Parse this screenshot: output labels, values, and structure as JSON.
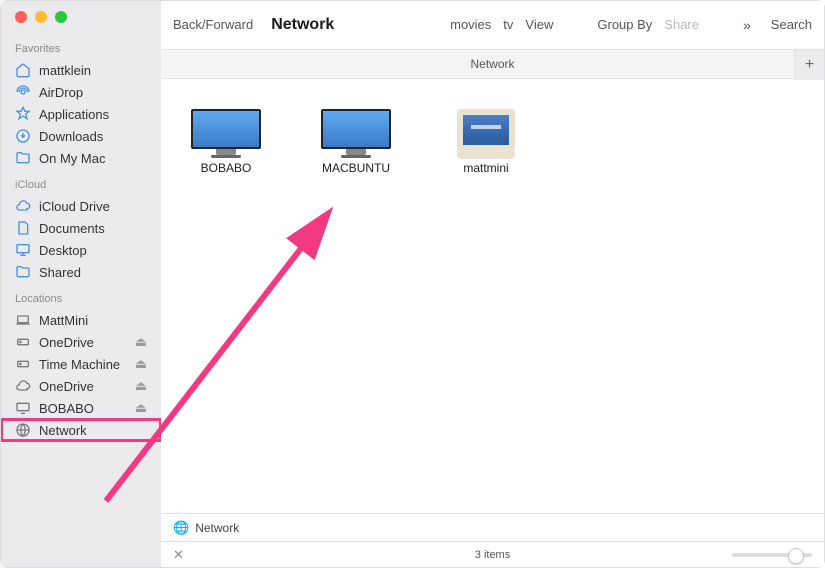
{
  "toolbar": {
    "nav_label": "Back/Forward",
    "title": "Network",
    "movies": "movies",
    "tv": "tv",
    "view": "View",
    "group_by": "Group By",
    "share": "Share",
    "search": "Search"
  },
  "header": {
    "title": "Network"
  },
  "sidebar": {
    "favorites_label": "Favorites",
    "favorites": [
      {
        "icon": "home-icon",
        "label": "mattklein"
      },
      {
        "icon": "airdrop-icon",
        "label": "AirDrop"
      },
      {
        "icon": "applications-icon",
        "label": "Applications"
      },
      {
        "icon": "downloads-icon",
        "label": "Downloads"
      },
      {
        "icon": "folder-icon",
        "label": "On My Mac"
      }
    ],
    "icloud_label": "iCloud",
    "icloud": [
      {
        "icon": "cloud-icon",
        "label": "iCloud Drive"
      },
      {
        "icon": "document-icon",
        "label": "Documents"
      },
      {
        "icon": "desktop-icon",
        "label": "Desktop"
      },
      {
        "icon": "folder-icon",
        "label": "Shared"
      }
    ],
    "locations_label": "Locations",
    "locations": [
      {
        "icon": "mac-icon",
        "label": "MattMini",
        "eject": false
      },
      {
        "icon": "disk-icon",
        "label": "OneDrive",
        "eject": true
      },
      {
        "icon": "disk-icon",
        "label": "Time Machine",
        "eject": true
      },
      {
        "icon": "cloud-icon",
        "label": "OneDrive",
        "eject": true
      },
      {
        "icon": "display-icon",
        "label": "BOBABO",
        "eject": true
      },
      {
        "icon": "network-icon",
        "label": "Network",
        "eject": false,
        "highlight": true
      }
    ]
  },
  "items": [
    {
      "name": "BOBABO",
      "type": "mac"
    },
    {
      "name": "MACBUNTU",
      "type": "mac"
    },
    {
      "name": "mattmini",
      "type": "pc"
    }
  ],
  "pathbar": {
    "label": "Network"
  },
  "statusbar": {
    "count": "3 items"
  }
}
